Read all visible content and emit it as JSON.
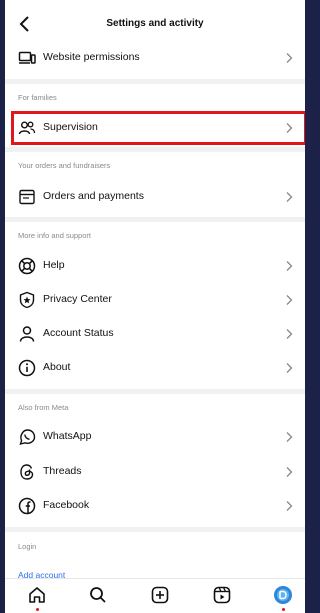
{
  "header": {
    "title": "Settings and activity"
  },
  "rows": {
    "website_permissions": "Website permissions",
    "supervision": "Supervision",
    "orders": "Orders and payments",
    "help": "Help",
    "privacy": "Privacy Center",
    "account_status": "Account Status",
    "about": "About",
    "whatsapp": "WhatsApp",
    "threads": "Threads",
    "facebook": "Facebook"
  },
  "sections": {
    "families": "For families",
    "orders": "Your orders and fundraisers",
    "support": "More info and support",
    "meta": "Also from Meta",
    "login": "Login"
  },
  "login": {
    "add_account": "Add account"
  },
  "colors": {
    "highlight": "#e0171f",
    "link": "#2f6df0",
    "background": "#1b2147"
  }
}
